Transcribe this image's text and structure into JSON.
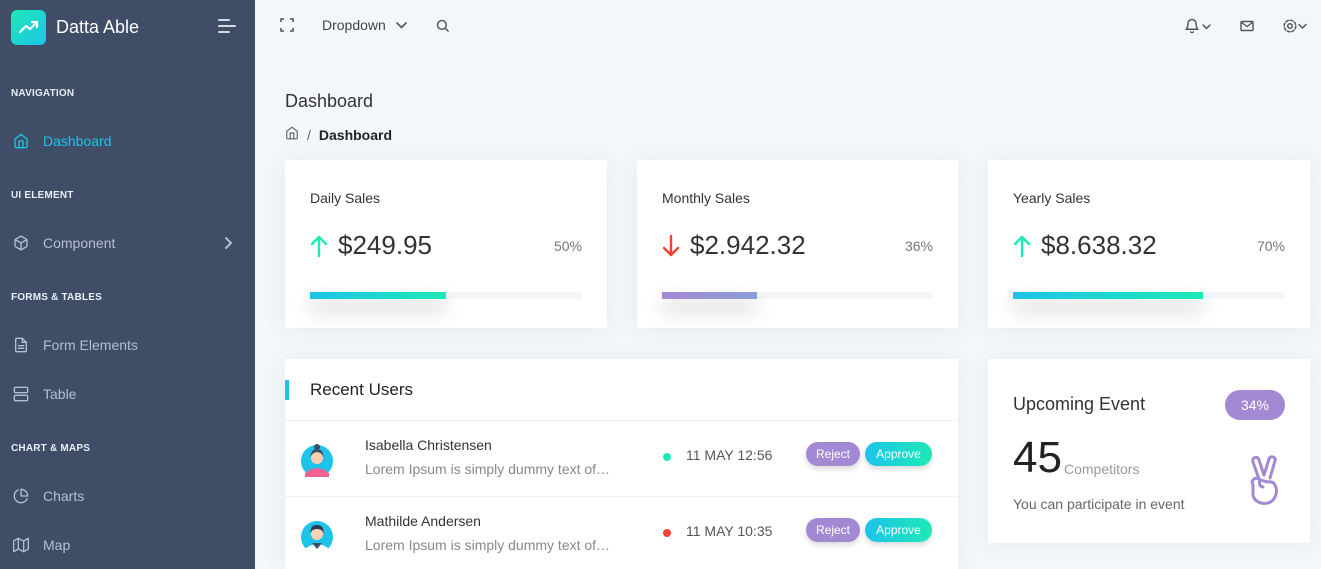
{
  "app": {
    "name": "Datta Able"
  },
  "sidebar": {
    "captions": [
      "NAVIGATION",
      "UI ELEMENT",
      "FORMS & TABLES",
      "CHART & MAPS"
    ],
    "items": [
      {
        "label": "Dashboard",
        "icon": "home-icon",
        "active": true
      },
      {
        "label": "Component",
        "icon": "box-icon"
      },
      {
        "label": "Form Elements",
        "icon": "file-text-icon"
      },
      {
        "label": "Table",
        "icon": "server-icon"
      },
      {
        "label": "Charts",
        "icon": "pie-chart-icon"
      },
      {
        "label": "Map",
        "icon": "map-icon"
      }
    ]
  },
  "header": {
    "dropdown_label": "Dropdown"
  },
  "page": {
    "title": "Dashboard",
    "breadcrumb_current": "Dashboard"
  },
  "stats": [
    {
      "title": "Daily Sales",
      "value": "$249.95",
      "trend": "up",
      "percent": "50%",
      "progress": 0.5
    },
    {
      "title": "Monthly Sales",
      "value": "$2.942.32",
      "trend": "down",
      "percent": "36%",
      "progress": 0.35
    },
    {
      "title": "Yearly Sales",
      "value": "$8.638.32",
      "trend": "up",
      "percent": "70%",
      "progress": 0.7
    }
  ],
  "recent_users": {
    "title": "Recent Users",
    "reject_label": "Reject",
    "approve_label": "Approve",
    "rows": [
      {
        "name": "Isabella Christensen",
        "desc": "Lorem Ipsum is simply dummy text of…",
        "date": "11 MAY 12:56",
        "status_color": "#1de9b6"
      },
      {
        "name": "Mathilde Andersen",
        "desc": "Lorem Ipsum is simply dummy text of…",
        "date": "11 MAY 10:35",
        "status_color": "#f44236"
      }
    ]
  },
  "event": {
    "title": "Upcoming Event",
    "badge": "34%",
    "count": "45",
    "count_label": "Competitors",
    "desc": "You can participate in event"
  },
  "colors": {
    "sidebar": "#3f4d67",
    "accent": "#1dc4e9",
    "green": "#1de9b6",
    "red": "#f44236",
    "purple": "#a389d4"
  }
}
